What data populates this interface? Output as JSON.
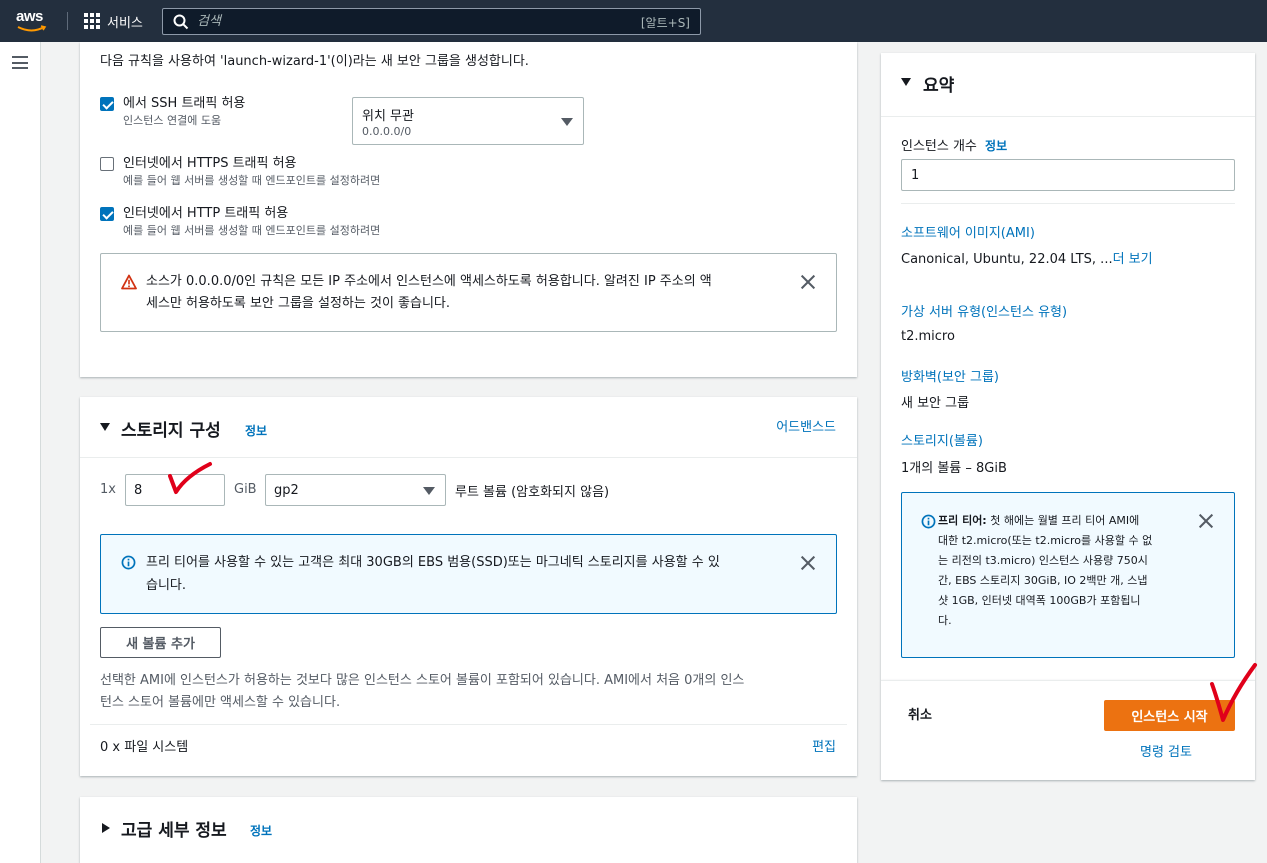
{
  "topnav": {
    "logo_text": "aws",
    "services_label": "서비스",
    "search_placeholder": "검색",
    "search_shortcut": "[알트+S]"
  },
  "security_group": {
    "description": "다음 규칙을 사용하여 'launch-wizard-1'(이)라는 새 보안 그룹을 생성합니다.",
    "rules": [
      {
        "label": "에서 SSH 트래픽 허용",
        "sub": "인스턴스 연결에 도움",
        "checked": true
      },
      {
        "label": "인터넷에서 HTTPS 트래픽 허용",
        "sub": "예를 들어 웹 서버를 생성할 때 엔드포인트를 설정하려면",
        "checked": false
      },
      {
        "label": "인터넷에서 HTTP 트래픽 허용",
        "sub": "예를 들어 웹 서버를 생성할 때 엔드포인트를 설정하려면",
        "checked": true
      }
    ],
    "source_select": {
      "value": "위치 무관",
      "sub": "0.0.0.0/0"
    },
    "warning_line1": "소스가 0.0.0.0/0인 규칙은 모든 IP 주소에서 인스턴스에 액세스하도록 허용합니다. 알려진 IP 주소의 액",
    "warning_line2": "세스만 허용하도록 보안 그룹을 설정하는 것이 좋습니다."
  },
  "storage": {
    "title": "스토리지 구성",
    "info": "정보",
    "advanced_link": "어드밴스드",
    "multiplier": "1x",
    "size_value": "8",
    "unit": "GiB",
    "volume_type": "gp2",
    "root_label": "루트 볼륨  (암호화되지 않음)",
    "info_line1": "프리 티어를 사용할 수 있는 고객은 최대 30GB의 EBS 범용(SSD)또는 마그네틱 스토리지를 사용할 수 있",
    "info_line2": "습니다.",
    "add_volume": "새 볼륨 추가",
    "note_line1": "선택한 AMI에 인스턴스가 허용하는 것보다 많은 인스턴스 스토어 볼륨이 포함되어 있습니다. AMI에서 처음 0개의 인스",
    "note_line2": "턴스 스토어 볼륨에만 액세스할 수 있습니다.",
    "file_systems": "0 x 파일 시스템",
    "edit": "편집"
  },
  "advanced": {
    "title": "고급 세부 정보",
    "info": "정보"
  },
  "summary": {
    "title": "요약",
    "instance_count_label": "인스턴스 개수",
    "info": "정보",
    "instance_count_value": "1",
    "ami_link": "소프트웨어 이미지(AMI)",
    "ami_value": "Canonical, Ubuntu, 22.04 LTS, ...",
    "ami_more": "더 보기",
    "type_link": "가상 서버 유형(인스턴스 유형)",
    "type_value": "t2.micro",
    "fw_link": "방화벽(보안 그룹)",
    "fw_value": "새 보안 그룹",
    "storage_link": "스토리지(볼륨)",
    "storage_value": "1개의 볼륨 – 8GiB",
    "free_tier_bold": "프리 티어:",
    "free_tier_l1": " 첫 해에는 월별 프리 티어 AMI에",
    "free_tier_l2": "대한 t2.micro(또는 t2.micro를 사용할 수 없",
    "free_tier_l3": "는 리전의 t3.micro) 인스턴스 사용량 750시",
    "free_tier_l4": "간, EBS 스토리지 30GiB, IO 2백만 개, 스냅",
    "free_tier_l5": "샷 1GB, 인터넷 대역폭 100GB가 포함됩니",
    "free_tier_l6": "다.",
    "cancel": "취소",
    "launch": "인스턴스 시작",
    "review": "명령 검토"
  },
  "colors": {
    "nav_bg": "#232f3e",
    "link": "#0073bb",
    "primary_button": "#ec7211",
    "annotation": "#e0001a",
    "warning": "#d13212"
  },
  "icons": [
    "grid-icon",
    "search-icon",
    "menu-icon",
    "warning-icon",
    "close-icon",
    "info-icon",
    "caret-down-icon",
    "check-mark-annotation"
  ]
}
